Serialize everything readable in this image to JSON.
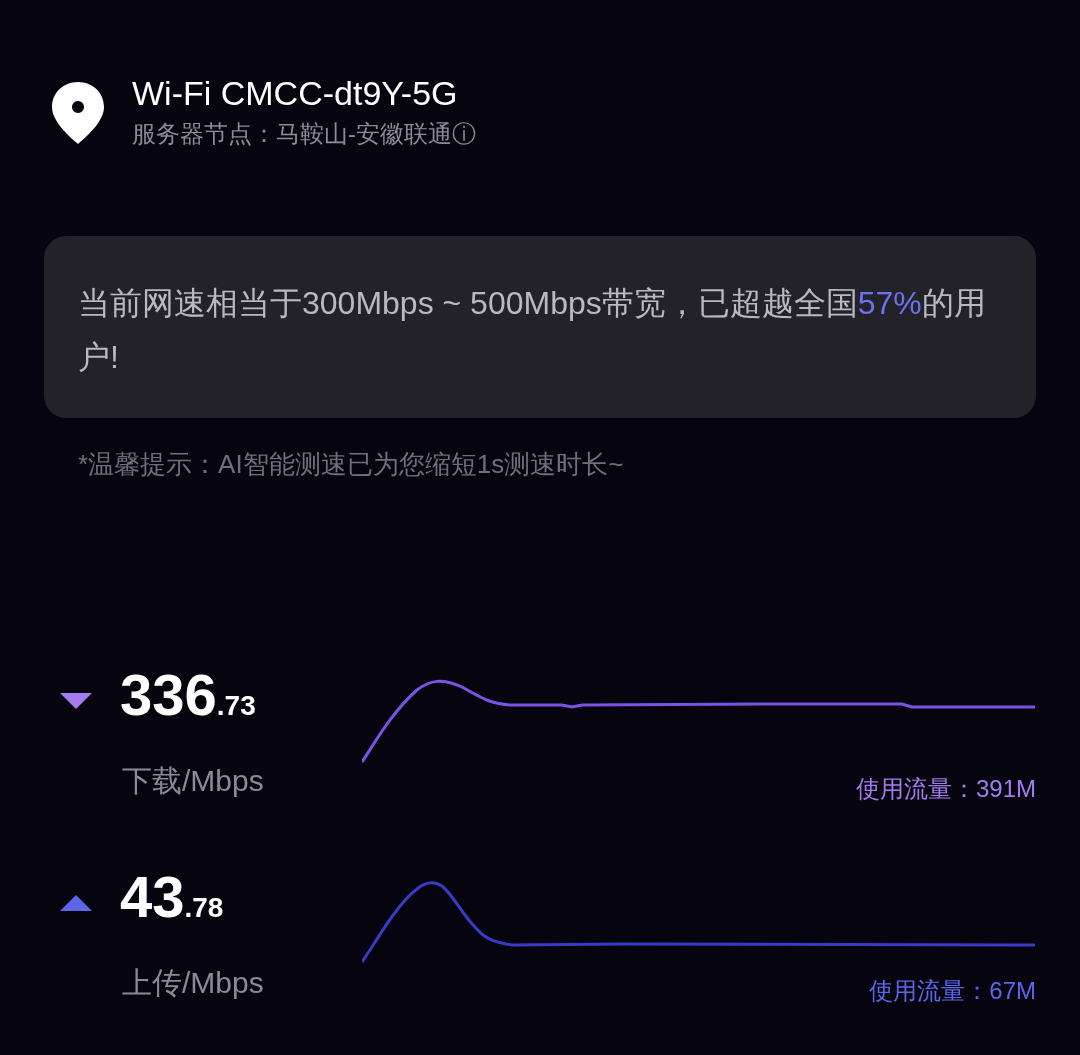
{
  "network": {
    "name": "Wi-Fi CMCC-dt9Y-5G",
    "server": "服务器节点：马鞍山-安徽联通",
    "info_icon": "ⓘ"
  },
  "summary": {
    "parts": [
      {
        "text": "当前网速相当于300Mbps ~ 500Mbps带宽，已超越全国",
        "highlight": false
      },
      {
        "text": "57%",
        "highlight": true
      },
      {
        "text": "的用户!",
        "highlight": false
      }
    ]
  },
  "tip": "*温馨提示：AI智能测速已为您缩短1s测速时长~",
  "metrics": [
    {
      "kind": "download",
      "integer": "336",
      "decimal": ".73",
      "unit": "下载/Mbps",
      "usage": "使用流量：391M",
      "color": "#a47cf0"
    },
    {
      "kind": "upload",
      "integer": "43",
      "decimal": ".78",
      "unit": "上传/Mbps",
      "usage": "使用流量：67M",
      "color": "#5b66ea"
    }
  ]
}
